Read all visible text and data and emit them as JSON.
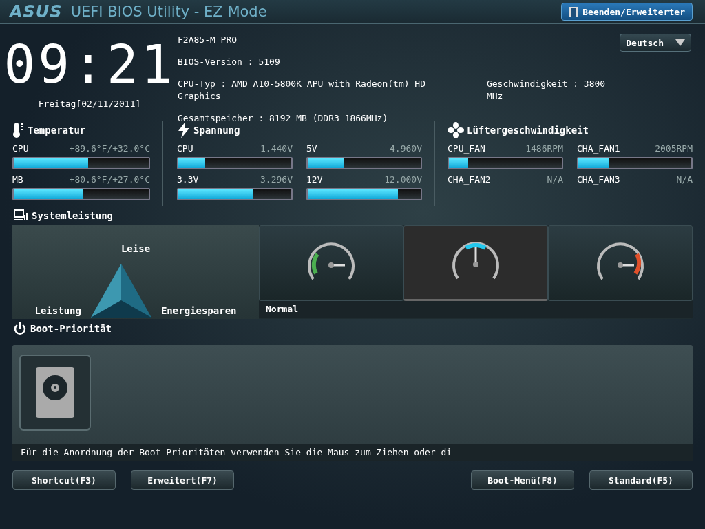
{
  "header": {
    "logo": "ASUS",
    "title": "UEFI BIOS Utility - EZ Mode",
    "exit_button": "Beenden/Erweiterter"
  },
  "clock": {
    "time": "09:21",
    "date": "Freitag[02/11/2011]"
  },
  "info": {
    "model": "F2A85-M PRO",
    "bios_version": "BIOS-Version : 5109",
    "cpu_type": "CPU-Typ : AMD A10-5800K APU with Radeon(tm) HD Graphics",
    "speed": "Geschwindigkeit : 3800 MHz",
    "memory": "Gesamtspeicher : 8192 MB (DDR3 1866MHz)"
  },
  "language": {
    "value": "Deutsch"
  },
  "temperature": {
    "title": "Temperatur",
    "items": [
      {
        "name": "CPU",
        "reading": "+89.6°F/+32.0°C",
        "level": 0.55
      },
      {
        "name": "MB",
        "reading": "+80.6°F/+27.0°C",
        "level": 0.51
      }
    ]
  },
  "voltage": {
    "title": "Spannung",
    "items": [
      {
        "name": "CPU",
        "reading": "1.440V",
        "level": 0.24
      },
      {
        "name": "5V",
        "reading": "4.960V",
        "level": 0.32
      },
      {
        "name": "3.3V",
        "reading": "3.296V",
        "level": 0.66
      },
      {
        "name": "12V",
        "reading": "12.000V",
        "level": 0.8
      }
    ]
  },
  "fans": {
    "title": "Lüftergeschwindigkeit",
    "items": [
      {
        "name": "CPU_FAN",
        "reading": "1486RPM",
        "level": 0.17
      },
      {
        "name": "CHA_FAN1",
        "reading": "2005RPM",
        "level": 0.27
      },
      {
        "name": "CHA_FAN2",
        "reading": "N/A"
      },
      {
        "name": "CHA_FAN3",
        "reading": "N/A"
      }
    ]
  },
  "performance": {
    "title": "Systemleistung",
    "triangle_labels": {
      "top": "Leise",
      "left": "Leistung",
      "right": "Energiesparen"
    },
    "modes": [
      {
        "kind": "quiet",
        "selected": false
      },
      {
        "kind": "normal",
        "selected": true
      },
      {
        "kind": "eco",
        "selected": false
      }
    ],
    "current_mode": "Normal"
  },
  "boot": {
    "title": "Boot-Priorität",
    "devices": [
      {
        "kind": "hdd"
      }
    ],
    "hint": "Für die Anordnung der Boot-Prioritäten verwenden Sie die Maus zum Ziehen oder di"
  },
  "footer_buttons": [
    "Shortcut(F3)",
    "Erweitert(F7)",
    "Boot-Menü(F8)",
    "Standard(F5)"
  ]
}
